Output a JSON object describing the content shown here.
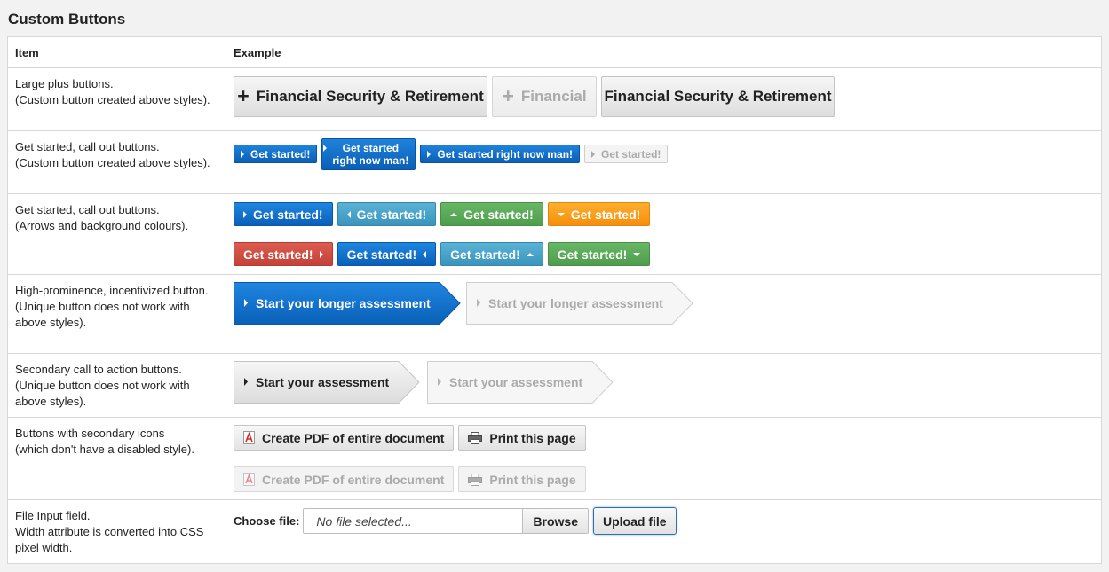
{
  "title": "Custom Buttons",
  "headers": {
    "item": "Item",
    "example": "Example"
  },
  "rows": [
    {
      "item": [
        "Large plus buttons.",
        "(Custom button created above styles)."
      ]
    },
    {
      "item": [
        "Get started, call out buttons.",
        "(Custom button created above styles)."
      ]
    },
    {
      "item": [
        "Get started, call out buttons.",
        "(Arrows and background colours)."
      ]
    },
    {
      "item": [
        "High-prominence, incentivized button.",
        "(Unique button does not work with above styles)."
      ]
    },
    {
      "item": [
        "Secondary call to action buttons.",
        "(Unique button does not work with above styles)."
      ]
    },
    {
      "item": [
        "Buttons with secondary icons",
        "(which don't have a disabled style)."
      ]
    },
    {
      "item": [
        "File Input field.",
        "Width attribute is converted into CSS pixel width."
      ]
    }
  ],
  "large_buttons": {
    "plus_label": "Financial Security & Retirement",
    "plus_disabled_label": "Financial",
    "plain_label": "Financial Security & Retirement"
  },
  "small_buttons": {
    "b1": "Get started!",
    "b2_line1": "Get started",
    "b2_line2": "right now man!",
    "b3": "Get started right now man!",
    "b4_disabled": "Get started!"
  },
  "colored_buttons": {
    "label": "Get started!",
    "colors": {
      "blue": "#0a66c2",
      "teal": "#4aa3c9",
      "green": "#5aaa59",
      "orange": "#f89c1c",
      "red": "#d14f44"
    }
  },
  "prominent": {
    "active": "Start your longer assessment",
    "disabled": "Start your longer assessment"
  },
  "secondary": {
    "active": "Start your assessment",
    "disabled": "Start your assessment"
  },
  "icon_buttons": {
    "pdf": "Create PDF of entire document",
    "print": "Print this page",
    "pdf_disabled": "Create PDF of entire document",
    "print_disabled": "Print this page",
    "pdf_icon": "pdf-icon",
    "print_icon": "printer-icon"
  },
  "file_input": {
    "label": "Choose file:",
    "placeholder": "No file selected...",
    "browse": "Browse",
    "upload": "Upload file"
  }
}
